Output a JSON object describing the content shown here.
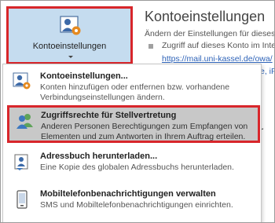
{
  "ribbon_button": {
    "label": "Kontoeinstellungen",
    "icon": "person-gear-icon"
  },
  "background": {
    "title": "Kontoeinstellungen",
    "subtitle": "Ändern der Einstellungen für dieses",
    "bullet_text": "Zugriff auf dieses Konto im Inte",
    "link": "https://mail.uni-kassel.de/owa/",
    "side_fragment": "e, iP",
    "side_char": "r"
  },
  "menu": {
    "items": [
      {
        "title": "Kontoeinstellungen...",
        "description": "Konten hinzufügen oder entfernen bzw. vorhandene Verbindungseinstellungen ändern.",
        "icon": "person-gear-icon",
        "highlighted": false
      },
      {
        "title": "Zugriffsrechte für Stellvertretung",
        "description": "Anderen Personen Berechtigungen zum Empfangen von Elementen und zum Antworten in Ihrem Auftrag erteilen.",
        "icon": "two-people-icon",
        "highlighted": true
      },
      {
        "title": "Adressbuch herunterladen...",
        "description": "Eine Kopie des globalen Adressbuchs herunterladen.",
        "icon": "address-book-download-icon",
        "highlighted": false
      },
      {
        "title": "Mobiltelefonbenachrichtigungen verwalten",
        "description": "SMS und Mobiltelefonbenachrichtigungen einrichten.",
        "icon": "mobile-phone-icon",
        "highlighted": false
      }
    ]
  },
  "colors": {
    "highlight_border": "#d8262b",
    "ribbon_button_bg": "#c5dcef",
    "highlight_bg": "#c8c8c8",
    "link": "#2e63b8"
  }
}
